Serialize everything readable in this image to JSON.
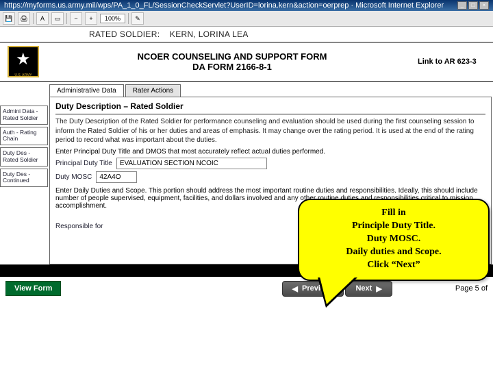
{
  "window": {
    "title": "https://myforms.us.army.mil/wps/PA_1_0_FL/SessionCheckServlet?UserID=lorina.kern&action=oerprep · Microsoft Internet Explorer"
  },
  "toolbar": {
    "zoom": "100%"
  },
  "rated": {
    "label": "RATED SOLDIER:",
    "name": "KERN, LORINA LEA"
  },
  "header": {
    "title1": "NCOER COUNSELING AND SUPPORT FORM",
    "title2": "DA FORM 2166-8-1",
    "link": "Link to AR 623-3"
  },
  "tabs": {
    "t0": "Administrative Data",
    "t1": "Rater Actions"
  },
  "sidebar": {
    "items": [
      {
        "label": "Admini Data - Rated Soldier"
      },
      {
        "label": "Auth - Rating Chain"
      },
      {
        "label": "Duty Des - Rated Soldier"
      },
      {
        "label": "Duty Des - Continued"
      }
    ]
  },
  "panel": {
    "sectionTitle": "Duty Description – Rated Soldier",
    "desc": "The Duty Description of the Rated Soldier for performance counseling and evaluation should be used during the first counseling session to inform the Rated Soldier of his or her duties and areas of emphasis. It may change over the rating period. It is used at the end of the rating period to record what was important about the duties.",
    "inst1": "Enter Principal Duty Title and DMOS that most accurately reflect actual duties performed.",
    "pdtLabel": "Principal Duty Title",
    "pdtValue": "EVALUATION SECTION NCOIC",
    "moscLabel": "Duty MOSC",
    "moscValue": "42A4O",
    "inst2": "Enter Daily Duties and Scope. This portion should address the most important routine duties and responsibilities. Ideally, this should include number of people supervised, equipment, facilities, and dollars involved and any other routine duties and responsibilities critical to mission accomplishment.",
    "respLabel": "Responsible for"
  },
  "nav": {
    "view": "View Form",
    "prev": "Previous",
    "next": "Next",
    "page": "Page 5 of"
  },
  "callout": {
    "l1": "Fill in",
    "l2": "Principle Duty Title.",
    "l3": "Duty MOSC.",
    "l4": "Daily duties and Scope.",
    "l5": "Click “Next”"
  }
}
